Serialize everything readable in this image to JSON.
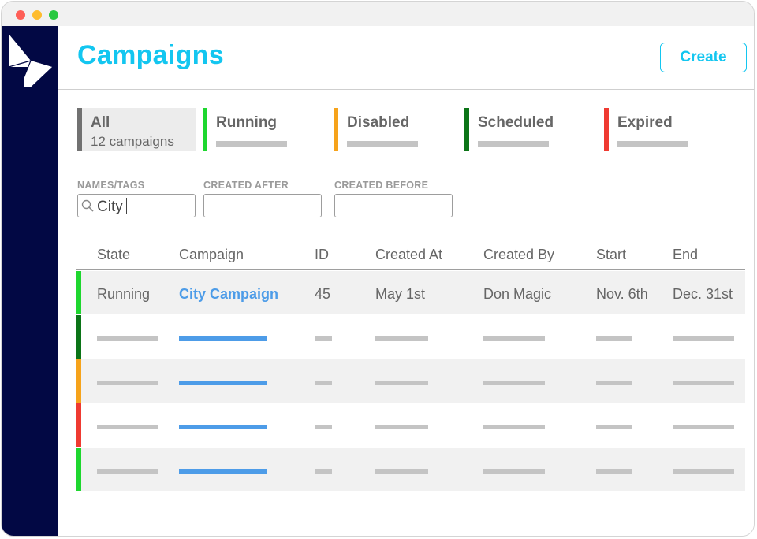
{
  "colors": {
    "accent": "#13c6f0",
    "sidebar": "#020844",
    "link": "#4d9ce8",
    "running": "#1ed72f",
    "disabled": "#f6a31b",
    "scheduled": "#0b7417",
    "expired": "#ef3a31",
    "all": "#717171"
  },
  "header": {
    "title": "Campaigns",
    "create_label": "Create"
  },
  "filter_tabs": [
    {
      "label": "All",
      "count": "12 campaigns",
      "color": "#717171"
    },
    {
      "label": "Running",
      "color": "#1ed72f"
    },
    {
      "label": "Disabled",
      "color": "#f6a31b"
    },
    {
      "label": "Scheduled",
      "color": "#0b7417"
    },
    {
      "label": "Expired",
      "color": "#ef3a31"
    }
  ],
  "filters": {
    "names_tags": {
      "label": "NAMES/TAGS",
      "value": "City"
    },
    "created_after": {
      "label": "CREATED AFTER",
      "value": ""
    },
    "created_before": {
      "label": "CREATED BEFORE",
      "value": ""
    }
  },
  "table": {
    "columns": [
      "State",
      "Campaign",
      "ID",
      "Created At",
      "Created By",
      "Start",
      "End"
    ],
    "rows": [
      {
        "state": "Running",
        "campaign": "City Campaign",
        "id": "45",
        "created_at": "May 1st",
        "created_by": "Don Magic",
        "start": "Nov. 6th",
        "end": "Dec. 31st",
        "color": "#1ed72f"
      },
      {
        "color": "#0b7417"
      },
      {
        "color": "#f6a31b"
      },
      {
        "color": "#ef3a31"
      },
      {
        "color": "#1ed72f"
      }
    ]
  },
  "icons": {
    "search": "search-icon",
    "logo": "logo-icon"
  }
}
